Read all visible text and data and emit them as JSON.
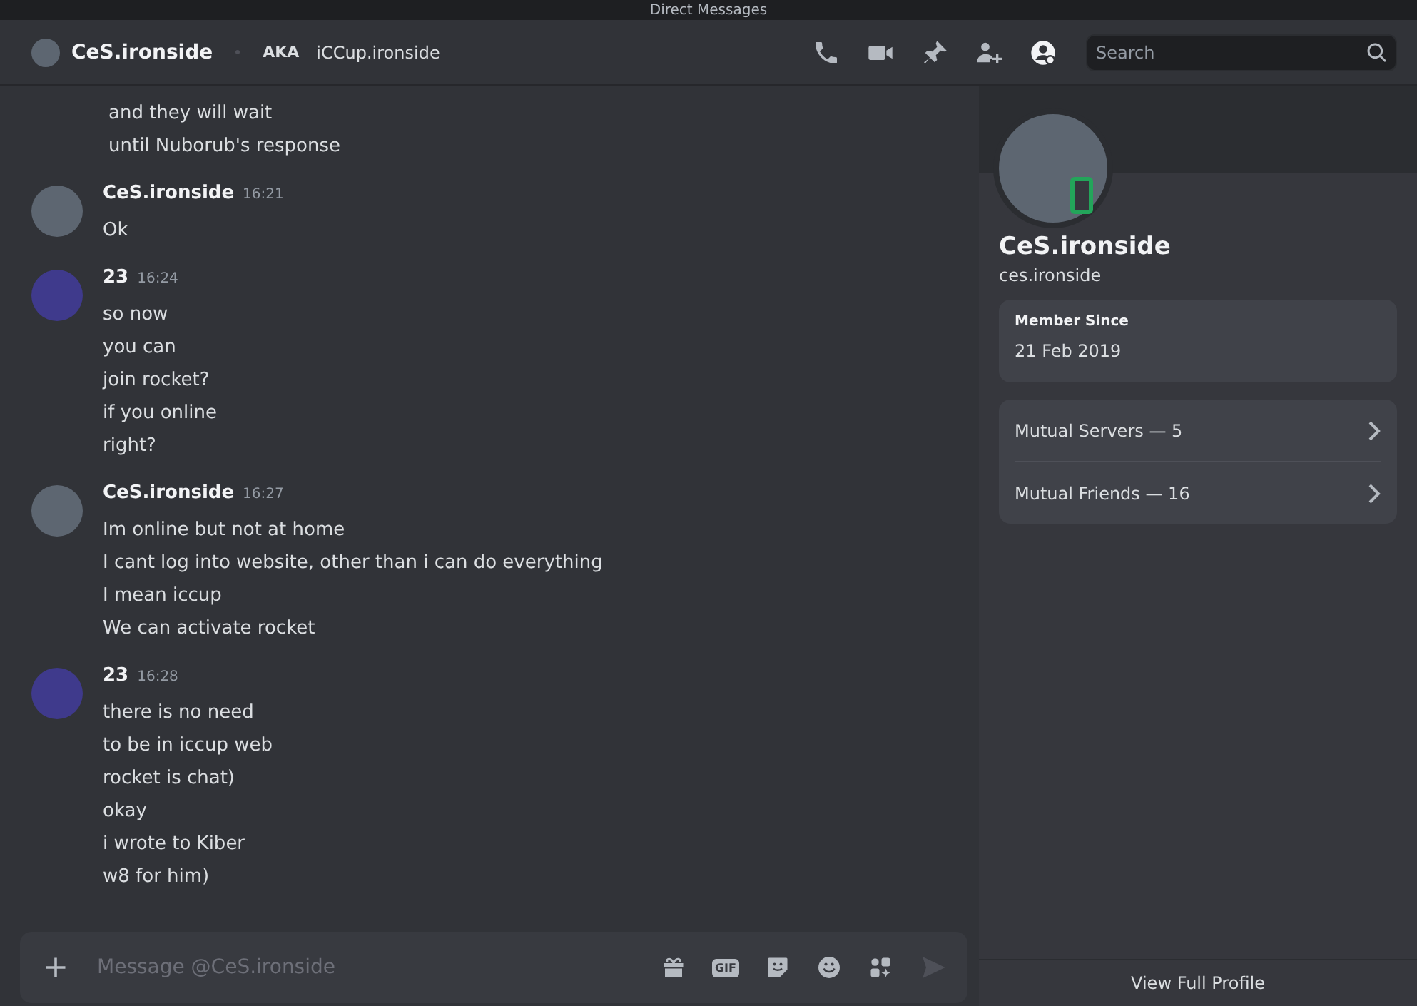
{
  "window": {
    "title": "Direct Messages"
  },
  "header": {
    "name": "CeS.ironside",
    "aka_label": "AKA",
    "aka": "iCCup.ironside",
    "search": {
      "placeholder": "Search"
    }
  },
  "messages": [
    {
      "kind": "continuation",
      "lines": [
        "and they will wait",
        "until Nuborub's response"
      ]
    },
    {
      "kind": "group",
      "author": "CeS.ironside",
      "color": "#5d6671",
      "time": "16:21",
      "lines": [
        "Ok"
      ]
    },
    {
      "kind": "group",
      "author": "23",
      "color": "#3f3a8c",
      "time": "16:24",
      "lines": [
        "so now",
        "you can",
        "join rocket?",
        "if you online",
        "right?"
      ]
    },
    {
      "kind": "group",
      "author": "CeS.ironside",
      "color": "#5d6671",
      "time": "16:27",
      "lines": [
        "Im online but not at home",
        "I cant log into website, other than i can do everything",
        "I mean iccup",
        "We can activate rocket"
      ]
    },
    {
      "kind": "group",
      "author": "23",
      "color": "#3f3a8c",
      "time": "16:28",
      "lines": [
        "there is no need",
        "to be in iccup web",
        "rocket is chat)",
        "okay",
        "i wrote to Kiber",
        "w8 for him)"
      ]
    }
  ],
  "composer": {
    "placeholder": "Message @CeS.ironside",
    "gif_label": "GIF"
  },
  "profile": {
    "display_name": "CeS.ironside",
    "username": "ces.ironside",
    "member_since_label": "Member Since",
    "member_since": "21 Feb 2019",
    "links": [
      {
        "label": "Mutual Servers — 5"
      },
      {
        "label": "Mutual Friends — 16"
      }
    ],
    "footer": "View Full Profile"
  }
}
